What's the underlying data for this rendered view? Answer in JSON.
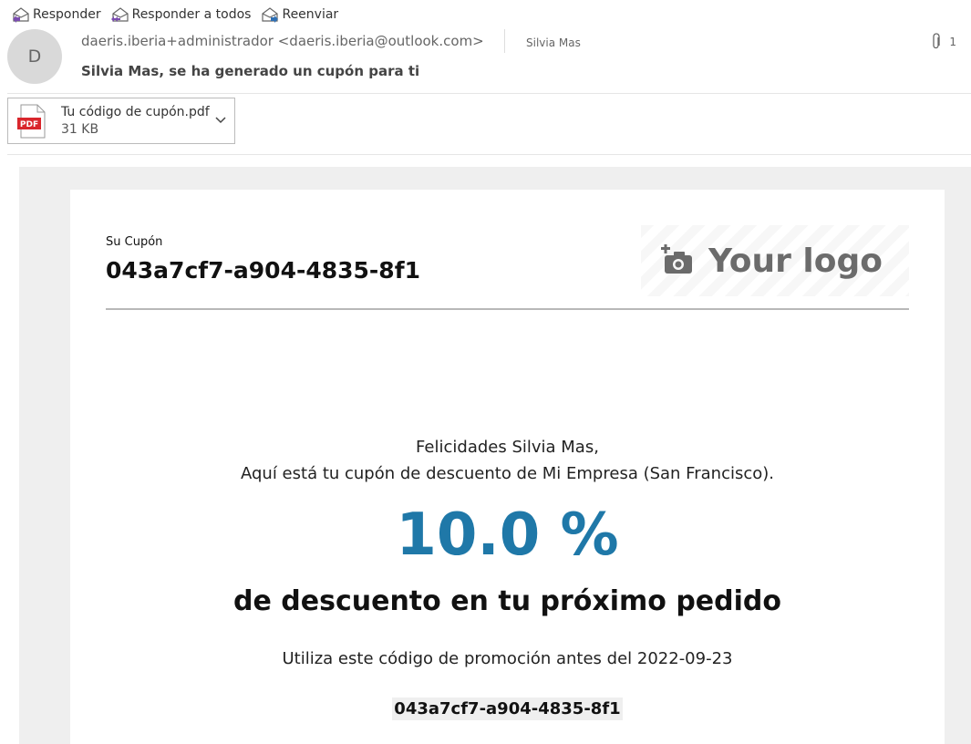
{
  "toolbar": {
    "reply": "Responder",
    "reply_all": "Responder a todos",
    "forward": "Reenviar"
  },
  "header": {
    "avatar_initial": "D",
    "from": "daeris.iberia+administrador <daeris.iberia@outlook.com>",
    "to": "Silvia Mas",
    "attachment_count": "1",
    "subject": "Silvia Mas, se ha generado un cupón para ti"
  },
  "attachment": {
    "icon_label": "PDF",
    "name": "Tu código de cupón.pdf",
    "size": "31 KB"
  },
  "email": {
    "coupon_label": "Su Cupón",
    "coupon_code": "043a7cf7-a904-4835-8f1",
    "logo_text": "Your logo",
    "greeting": "Felicidades Silvia Mas,",
    "message": "Aquí está tu cupón de descuento de Mi Empresa (San Francisco).",
    "discount": "10.0 %",
    "discount_desc": "de descuento en tu próximo pedido",
    "validity": "Utiliza este código de promoción antes del 2022-09-23",
    "promo_code": "043a7cf7-a904-4835-8f1"
  },
  "colors": {
    "discount": "#1f78a8",
    "pdf_red": "#d9262c"
  }
}
